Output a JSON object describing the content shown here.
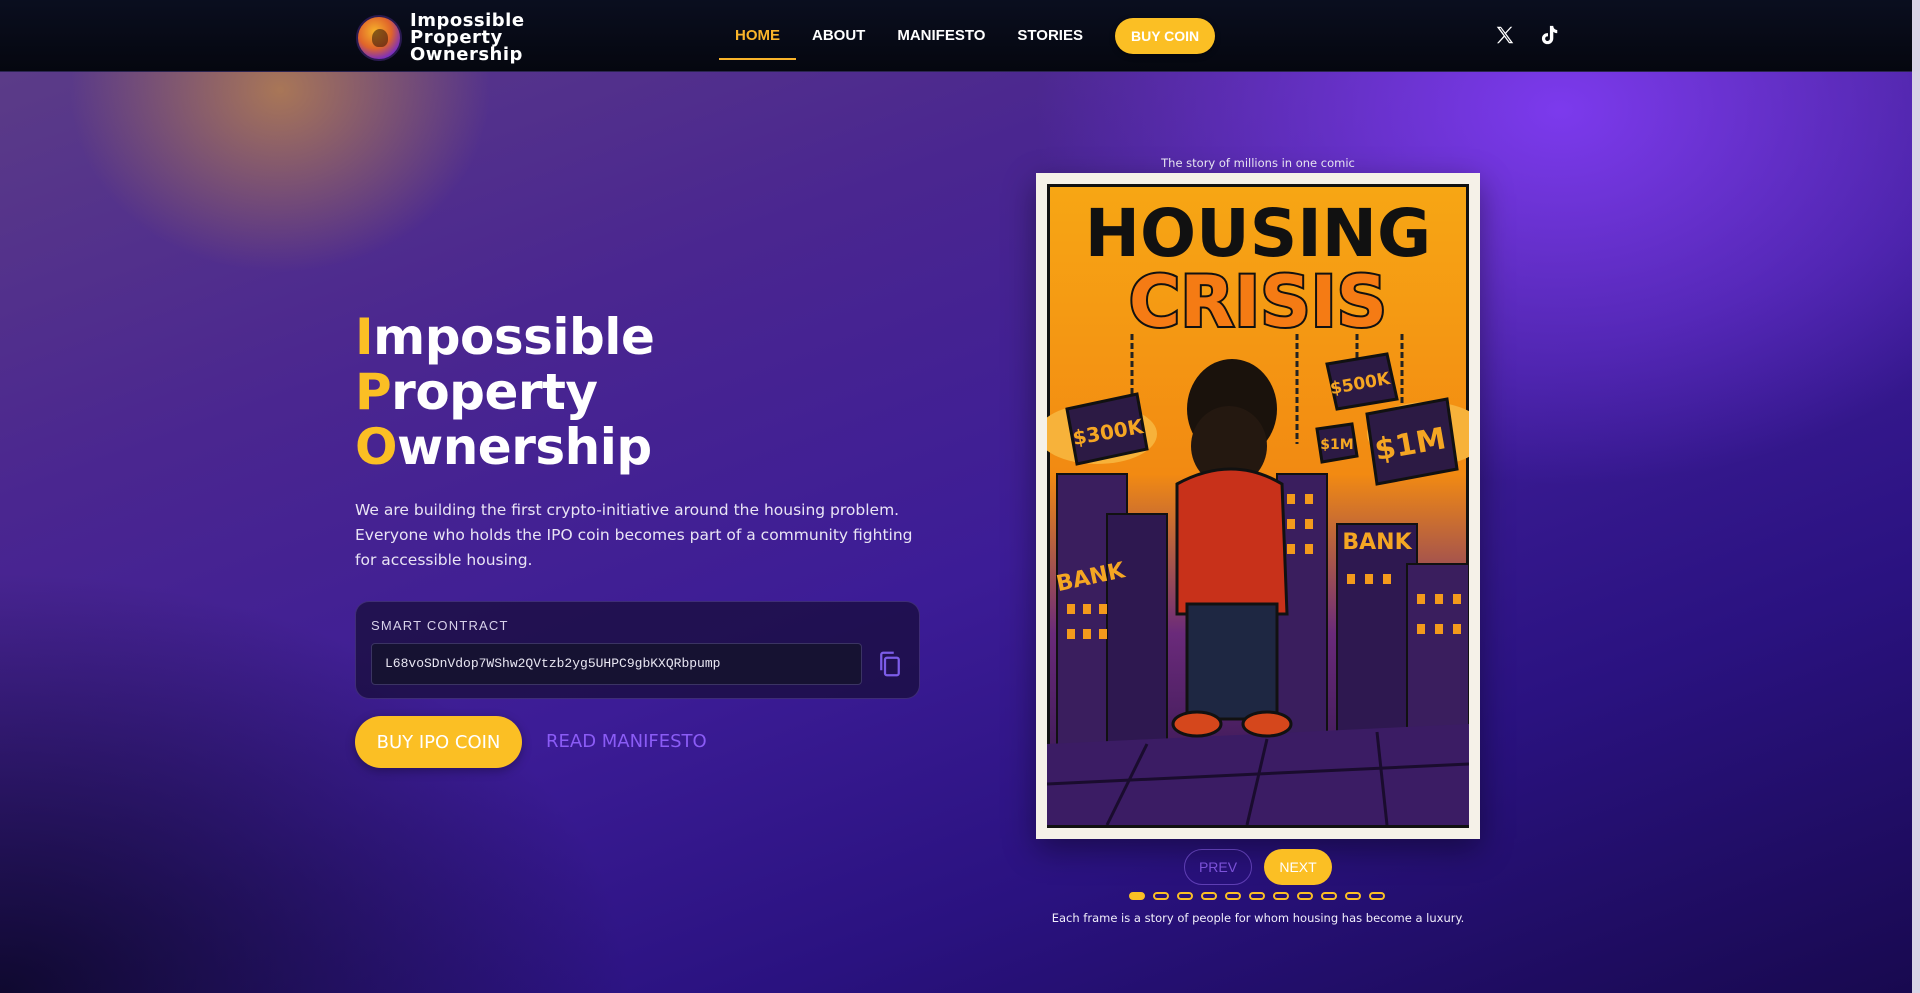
{
  "brand": {
    "name_lines": [
      "Impossible",
      "Property",
      "Ownership"
    ]
  },
  "nav": {
    "items": [
      {
        "label": "HOME",
        "active": true
      },
      {
        "label": "ABOUT",
        "active": false
      },
      {
        "label": "MANIFESTO",
        "active": false
      },
      {
        "label": "STORIES",
        "active": false
      }
    ],
    "buy_label": "BUY COIN",
    "socials": [
      "x-icon",
      "tiktok-icon"
    ]
  },
  "hero": {
    "title_lines": [
      {
        "cap": "I",
        "rest": "mpossible"
      },
      {
        "cap": "P",
        "rest": "roperty"
      },
      {
        "cap": "O",
        "rest": "wnership"
      }
    ],
    "description": "We are building the first crypto-initiative around the housing problem. Everyone who holds the IPO coin becomes part of a community fighting for accessible housing.",
    "contract": {
      "label": "SMART CONTRACT",
      "address": "L68voSDnVdop7WShw2QVtzb2yg5UHPC9gbKXQRbpump",
      "copy_icon": "copy-icon"
    },
    "buy_button": "BUY IPO COIN",
    "manifesto_link": "READ MANIFESTO"
  },
  "comic": {
    "caption": "The story of millions in one comic",
    "art_text": {
      "title_top": "HOUSING",
      "title_bottom": "CRISIS",
      "price_tags": [
        "$300K",
        "$500K",
        "$1M",
        "$1M"
      ],
      "signs": [
        "BANK",
        "BANK"
      ]
    },
    "prev_label": "PREV",
    "next_label": "NEXT",
    "total_frames": 11,
    "current_frame": 1,
    "footnote": "Each frame is a story of people for whom housing has become a luxury."
  },
  "colors": {
    "accent": "#fbbf24",
    "purple": "#8b5cf6",
    "nav_bg": "#05070f"
  }
}
